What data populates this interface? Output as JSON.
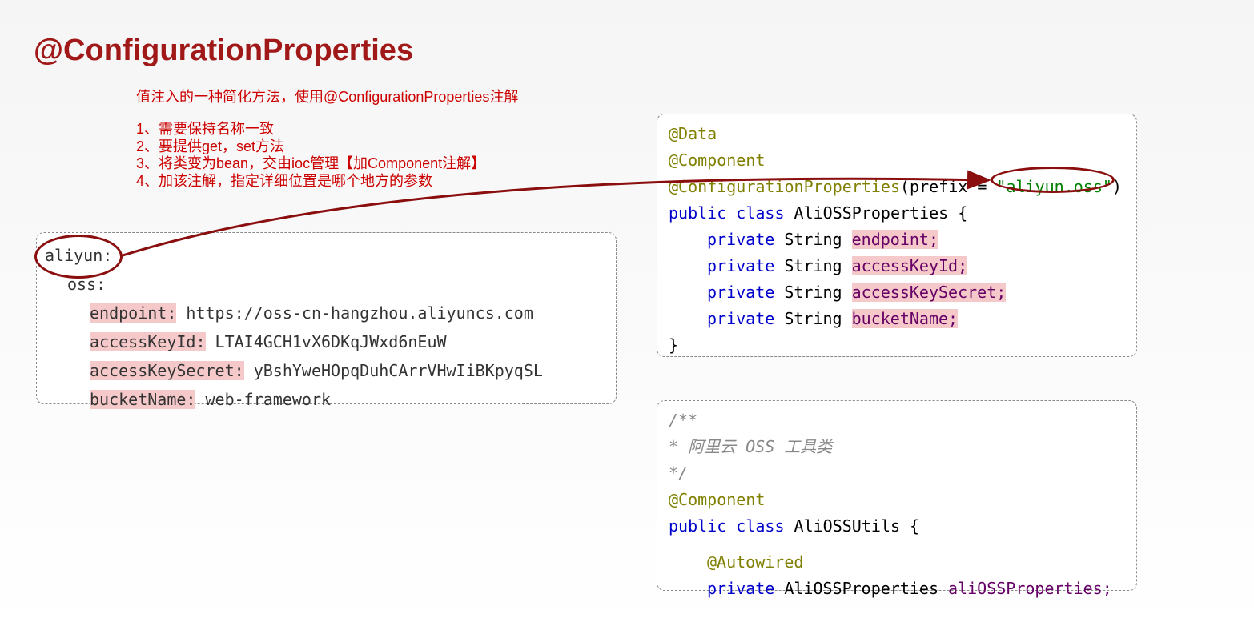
{
  "title": "@ConfigurationProperties",
  "intro": {
    "line1": "值注入的一种简化方法，使用@ConfigurationProperties注解",
    "line2": "1、需要保持名称一致",
    "line3": "2、要提供get，set方法",
    "line4": "3、将类变为bean，交由ioc管理【加Component注解】",
    "line5": "4、加该注解，指定详细位置是哪个地方的参数"
  },
  "yaml": {
    "l1": "aliyun:",
    "l2": "oss:",
    "l3_key": "endpoint:",
    "l3_val": " https://oss-cn-hangzhou.aliyuncs.com",
    "l4_key": "accessKeyId:",
    "l4_val": " LTAI4GCH1vX6DKqJWxd6nEuW",
    "l5_key": "accessKeySecret:",
    "l5_val": " yBshYweHOpqDuhCArrVHwIiBKpyqSL",
    "l6_key": "bucketName:",
    "l6_val": " web-framework"
  },
  "java1": {
    "l1": "@Data",
    "l2": "@Component",
    "l3a": "@ConfigurationProperties",
    "l3b": "(prefix = ",
    "l3c": "\"aliyun.oss\"",
    "l3d": ")",
    "l4a": "public class",
    "l4b": " AliOSSProperties {",
    "l5a": "private",
    "l5b": " String ",
    "l5c": "endpoint;",
    "l6a": "private",
    "l6b": " String ",
    "l6c": "accessKeyId;",
    "l7a": "private",
    "l7b": " String ",
    "l7c": "accessKeySecret;",
    "l8a": "private",
    "l8b": " String ",
    "l8c": "bucketName;",
    "l9": "}"
  },
  "java2": {
    "l1": "/**",
    "l2": " * 阿里云 OSS 工具类",
    "l3": " */",
    "l4": "@Component",
    "l5a": "public class",
    "l5b": " AliOSSUtils {",
    "l6": "@Autowired",
    "l7a": "private",
    "l7b": " AliOSSProperties ",
    "l7c": "aliOSSProperties;"
  }
}
